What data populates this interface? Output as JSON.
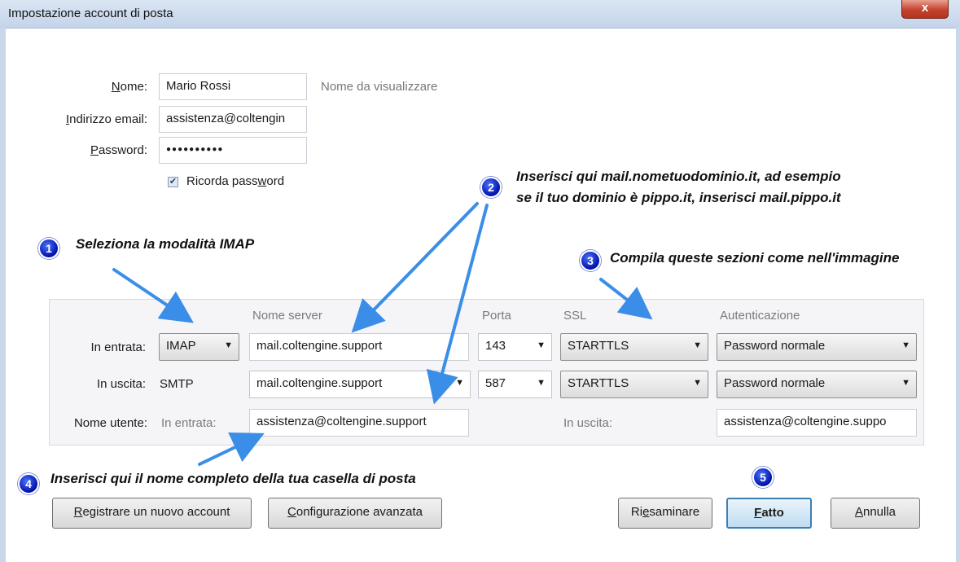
{
  "window": {
    "title": "Impostazione account di posta",
    "close_label": "x"
  },
  "form": {
    "name_label_u": "N",
    "name_label_rest": "ome:",
    "name_value": "Mario Rossi",
    "name_hint": "Nome da visualizzare",
    "email_label_u": "I",
    "email_label_rest": "ndirizzo email:",
    "email_value": "assistenza@coltengin",
    "password_label_u": "P",
    "password_label_rest": "assword:",
    "password_value": "●●●●●●●●●●",
    "remember_label_a": "Ricorda pass",
    "remember_label_u": "w",
    "remember_label_b": "ord",
    "remember_checked": true
  },
  "server_panel": {
    "headers": {
      "server": "Nome server",
      "port": "Porta",
      "ssl": "SSL",
      "auth": "Autenticazione"
    },
    "incoming": {
      "label": "In entrata:",
      "protocol": "IMAP",
      "server": "mail.coltengine.support",
      "port": "143",
      "ssl": "STARTTLS",
      "auth": "Password normale"
    },
    "outgoing": {
      "label": "In uscita:",
      "protocol": "SMTP",
      "server": "mail.coltengine.support",
      "port": "587",
      "ssl": "STARTTLS",
      "auth": "Password normale"
    },
    "username": {
      "label": "Nome utente:",
      "incoming_label": "In entrata:",
      "incoming_value": "assistenza@coltengine.support",
      "outgoing_label": "In uscita:",
      "outgoing_value": "assistenza@coltengine.suppo"
    }
  },
  "buttons": {
    "new_account_u": "R",
    "new_account_rest": "egistrare un nuovo account",
    "advanced_u": "C",
    "advanced_rest": "onfigurazione avanzata",
    "retest_a": "Ri",
    "retest_u": "e",
    "retest_b": "saminare",
    "done_u": "F",
    "done_rest": "atto",
    "cancel_u": "A",
    "cancel_rest": "nnulla"
  },
  "annotations": {
    "note1": {
      "badge": "1",
      "text": "Seleziona la modalità IMAP"
    },
    "note2": {
      "badge": "2",
      "line1": "Inserisci qui mail.nometuodominio.it, ad esempio",
      "line2": "se il tuo dominio è pippo.it, inserisci mail.pippo.it"
    },
    "note3": {
      "badge": "3",
      "text": "Compila queste sezioni come nell'immagine"
    },
    "note4": {
      "badge": "4",
      "text": "Inserisci qui il nome completo della tua casella di posta"
    },
    "note5": {
      "badge": "5"
    }
  },
  "colors": {
    "arrow": "#3b8ee8",
    "badge": "#0010a8",
    "default_button": "#3c7fb1"
  }
}
